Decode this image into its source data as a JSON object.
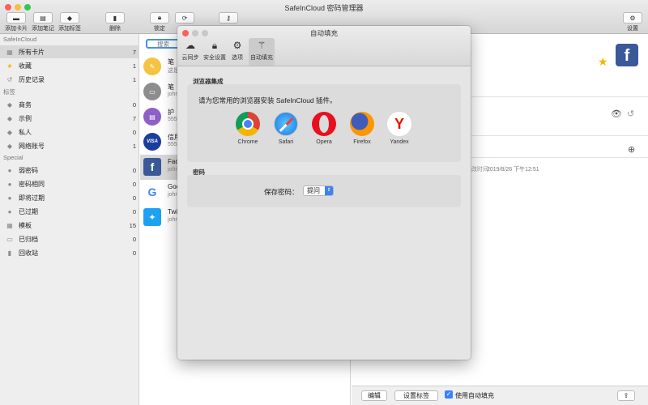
{
  "window": {
    "title": "SafeInCloud 密码管理器",
    "traffic_colors": [
      "#fc605b",
      "#fdbc40",
      "#34c84a"
    ]
  },
  "toolbar": {
    "add_card": "添加卡片",
    "add_note": "添加笔记",
    "add_tag": "添加标签",
    "delete": "删除",
    "lock": "锁定",
    "settings": "设置"
  },
  "sidebar": {
    "header_app": "SafeInCloud",
    "header_tags": "标签",
    "header_special": "Special",
    "items": [
      {
        "label": "所有卡片",
        "count": "7",
        "icon": "grid-icon"
      },
      {
        "label": "收藏",
        "count": "1",
        "icon": "star-icon"
      },
      {
        "label": "历史记录",
        "count": "1",
        "icon": "history-icon"
      },
      {
        "label": "商务",
        "count": "0",
        "icon": "tag-icon"
      },
      {
        "label": "示例",
        "count": "7",
        "icon": "tag-icon"
      },
      {
        "label": "私人",
        "count": "0",
        "icon": "tag-icon"
      },
      {
        "label": "网络账号",
        "count": "1",
        "icon": "tag-icon"
      },
      {
        "label": "弱密码",
        "count": "0",
        "icon": "alert-icon"
      },
      {
        "label": "密码相同",
        "count": "0",
        "icon": "alert-icon"
      },
      {
        "label": "即将过期",
        "count": "0",
        "icon": "alert-icon"
      },
      {
        "label": "已过期",
        "count": "0",
        "icon": "alert-icon"
      },
      {
        "label": "模板",
        "count": "15",
        "icon": "template-icon"
      },
      {
        "label": "已归档",
        "count": "0",
        "icon": "archive-icon"
      },
      {
        "label": "回收站",
        "count": "0",
        "icon": "trash-icon"
      }
    ]
  },
  "list": {
    "search_placeholder": "搜索",
    "rows": [
      {
        "title": "笔",
        "sub": "这是",
        "color": "#f5c342",
        "glyph": "✎"
      },
      {
        "title": "笔",
        "sub": "john",
        "color": "#8d8d8d",
        "glyph": "▭"
      },
      {
        "title": "护",
        "sub": "555",
        "color": "#8e5fc6",
        "glyph": "▤"
      },
      {
        "title": "信用",
        "sub": "555",
        "color": "#1a3e9c",
        "glyph": "VISA"
      },
      {
        "title": "Fac",
        "sub": "john",
        "color": "#3b5998",
        "glyph": "f"
      },
      {
        "title": "Goo",
        "sub": "john",
        "color": "#ffffff",
        "glyph": "G"
      },
      {
        "title": "Twi",
        "sub": "john",
        "color": "#1da1f2",
        "glyph": "🐦"
      }
    ]
  },
  "detail": {
    "modified_label": "改时间:",
    "modified_value": "2019/8/26 下午12:51",
    "edit": "编辑",
    "set_tags": "设置标签",
    "use_autofill": "使用自动填充",
    "autofill_checked": true
  },
  "dialog": {
    "title": "自动填充",
    "tabs": [
      {
        "label": "云同步",
        "icon": "cloud-icon"
      },
      {
        "label": "安全设置",
        "icon": "lock-icon"
      },
      {
        "label": "选项",
        "icon": "gear-icon"
      },
      {
        "label": "自动填充",
        "icon": "magic-wand-icon"
      }
    ],
    "browser_section": "浏览器集成",
    "install_prompt": "请为您常用的浏览器安装 SafeInCloud 插件。",
    "browsers": [
      "Chrome",
      "Safari",
      "Opera",
      "Firefox",
      "Yandex"
    ],
    "password_section": "密码",
    "save_password_label": "保存密码：",
    "save_password_value": "提问"
  }
}
